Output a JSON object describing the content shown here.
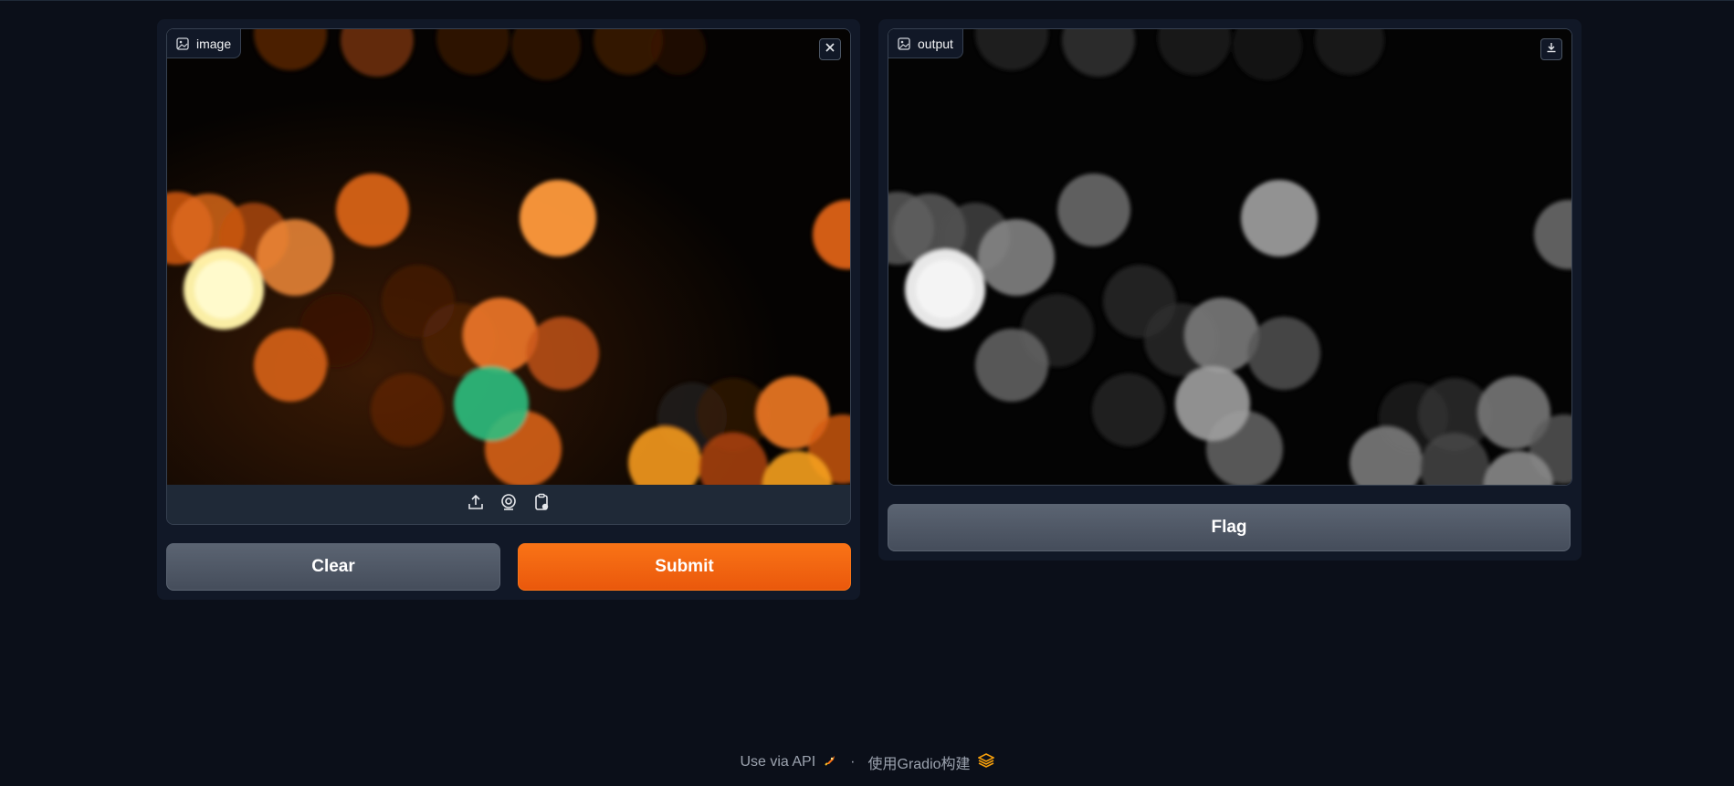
{
  "input": {
    "label": "image",
    "icons": {
      "label_icon": "image-icon",
      "clear": "close-icon",
      "upload": "upload-icon",
      "webcam": "webcam-icon",
      "paste": "clipboard-icon"
    }
  },
  "output": {
    "label": "output",
    "icons": {
      "label_icon": "image-icon",
      "download": "download-icon"
    }
  },
  "buttons": {
    "clear": "Clear",
    "submit": "Submit",
    "flag": "Flag"
  },
  "footer": {
    "api": "Use via API",
    "separator": "·",
    "built_with": "使用Gradio构建"
  },
  "colors": {
    "background": "#0b0f19",
    "panel": "#111827",
    "primary": "#f97316",
    "secondary": "#4b5563"
  }
}
